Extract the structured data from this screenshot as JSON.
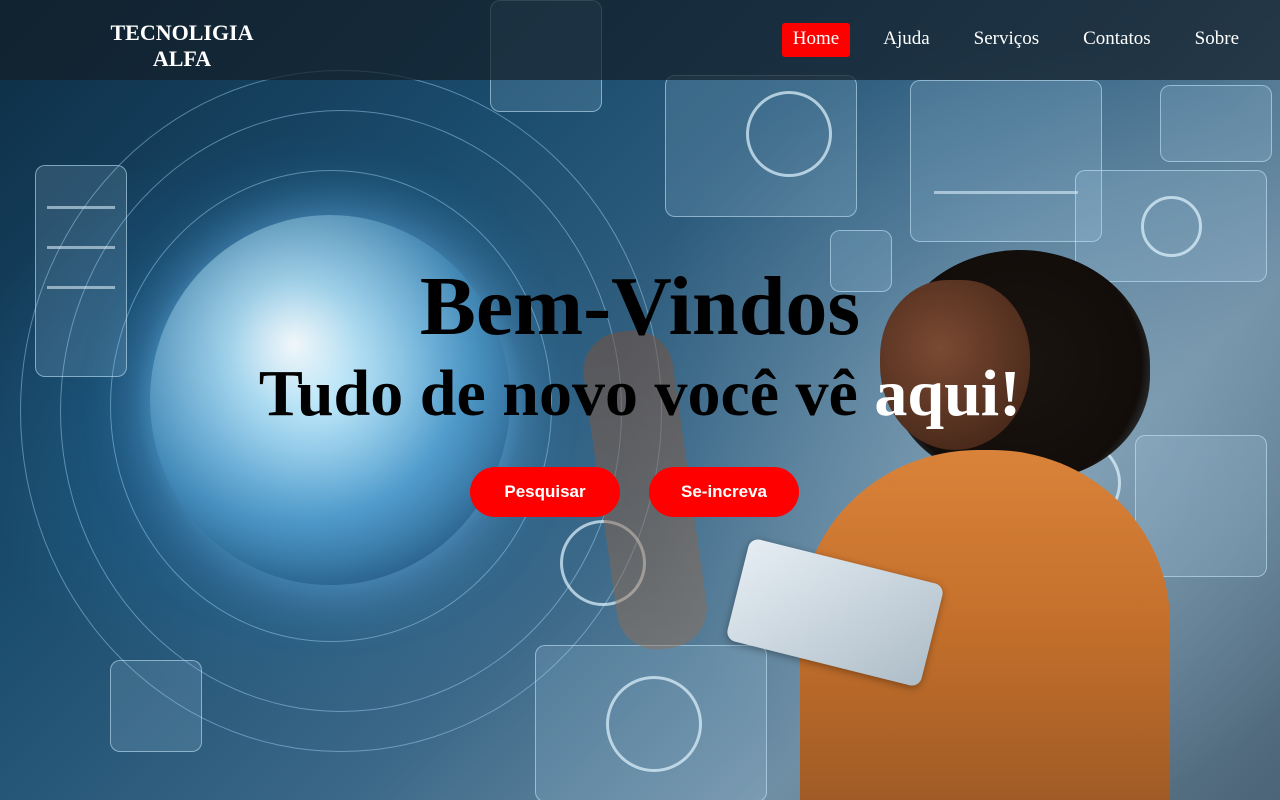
{
  "brand": {
    "line1": "TECNOLIGIA",
    "line2": "ALFA"
  },
  "nav": {
    "items": [
      {
        "label": "Home",
        "active": true
      },
      {
        "label": "Ajuda"
      },
      {
        "label": "Serviços"
      },
      {
        "label": "Contatos"
      },
      {
        "label": "Sobre"
      }
    ]
  },
  "hero": {
    "title": "Bem-Vindos",
    "subtitle_dark": "Tudo de novo você vê ",
    "subtitle_light": "aqui!",
    "background_image": "technology-globe-woman-holographic-interface"
  },
  "actions": {
    "search_label": "Pesquisar",
    "subscribe_label": "Se-increva"
  },
  "colors": {
    "accent": "#ff0000",
    "nav_bg": "#1e2a36",
    "text_dark": "#000000",
    "text_light": "#ffffff"
  }
}
